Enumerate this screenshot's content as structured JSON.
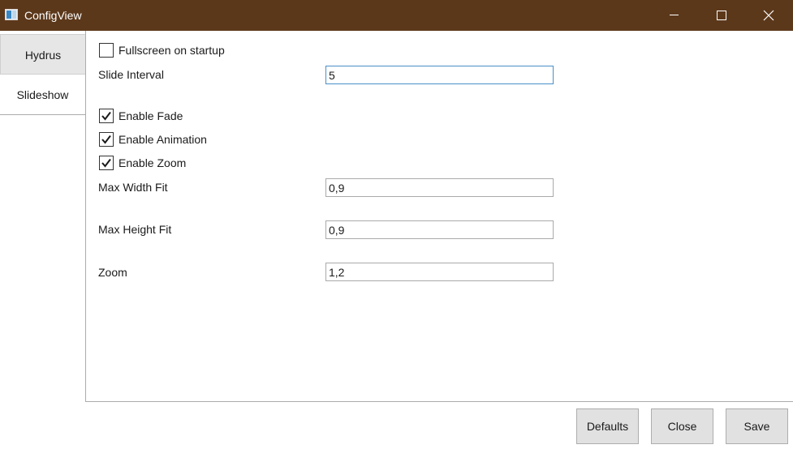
{
  "window": {
    "title": "ConfigView",
    "icon": "app-window-icon",
    "titlebar_color": "#5c381b"
  },
  "tabs": [
    {
      "label": "Hydrus",
      "selected": false
    },
    {
      "label": "Slideshow",
      "selected": true
    }
  ],
  "slideshow": {
    "fullscreen_on_startup": {
      "label": "Fullscreen on startup",
      "checked": false
    },
    "slide_interval": {
      "label": "Slide Interval",
      "value": "5"
    },
    "enable_fade": {
      "label": "Enable Fade",
      "checked": true
    },
    "enable_animation": {
      "label": "Enable Animation",
      "checked": true
    },
    "enable_zoom": {
      "label": "Enable Zoom",
      "checked": true
    },
    "max_width_fit": {
      "label": "Max Width Fit",
      "value": "0,9"
    },
    "max_height_fit": {
      "label": "Max Height Fit",
      "value": "0,9"
    },
    "zoom": {
      "label": "Zoom",
      "value": "1,2"
    }
  },
  "buttons": {
    "defaults": "Defaults",
    "close": "Close",
    "save": "Save"
  }
}
